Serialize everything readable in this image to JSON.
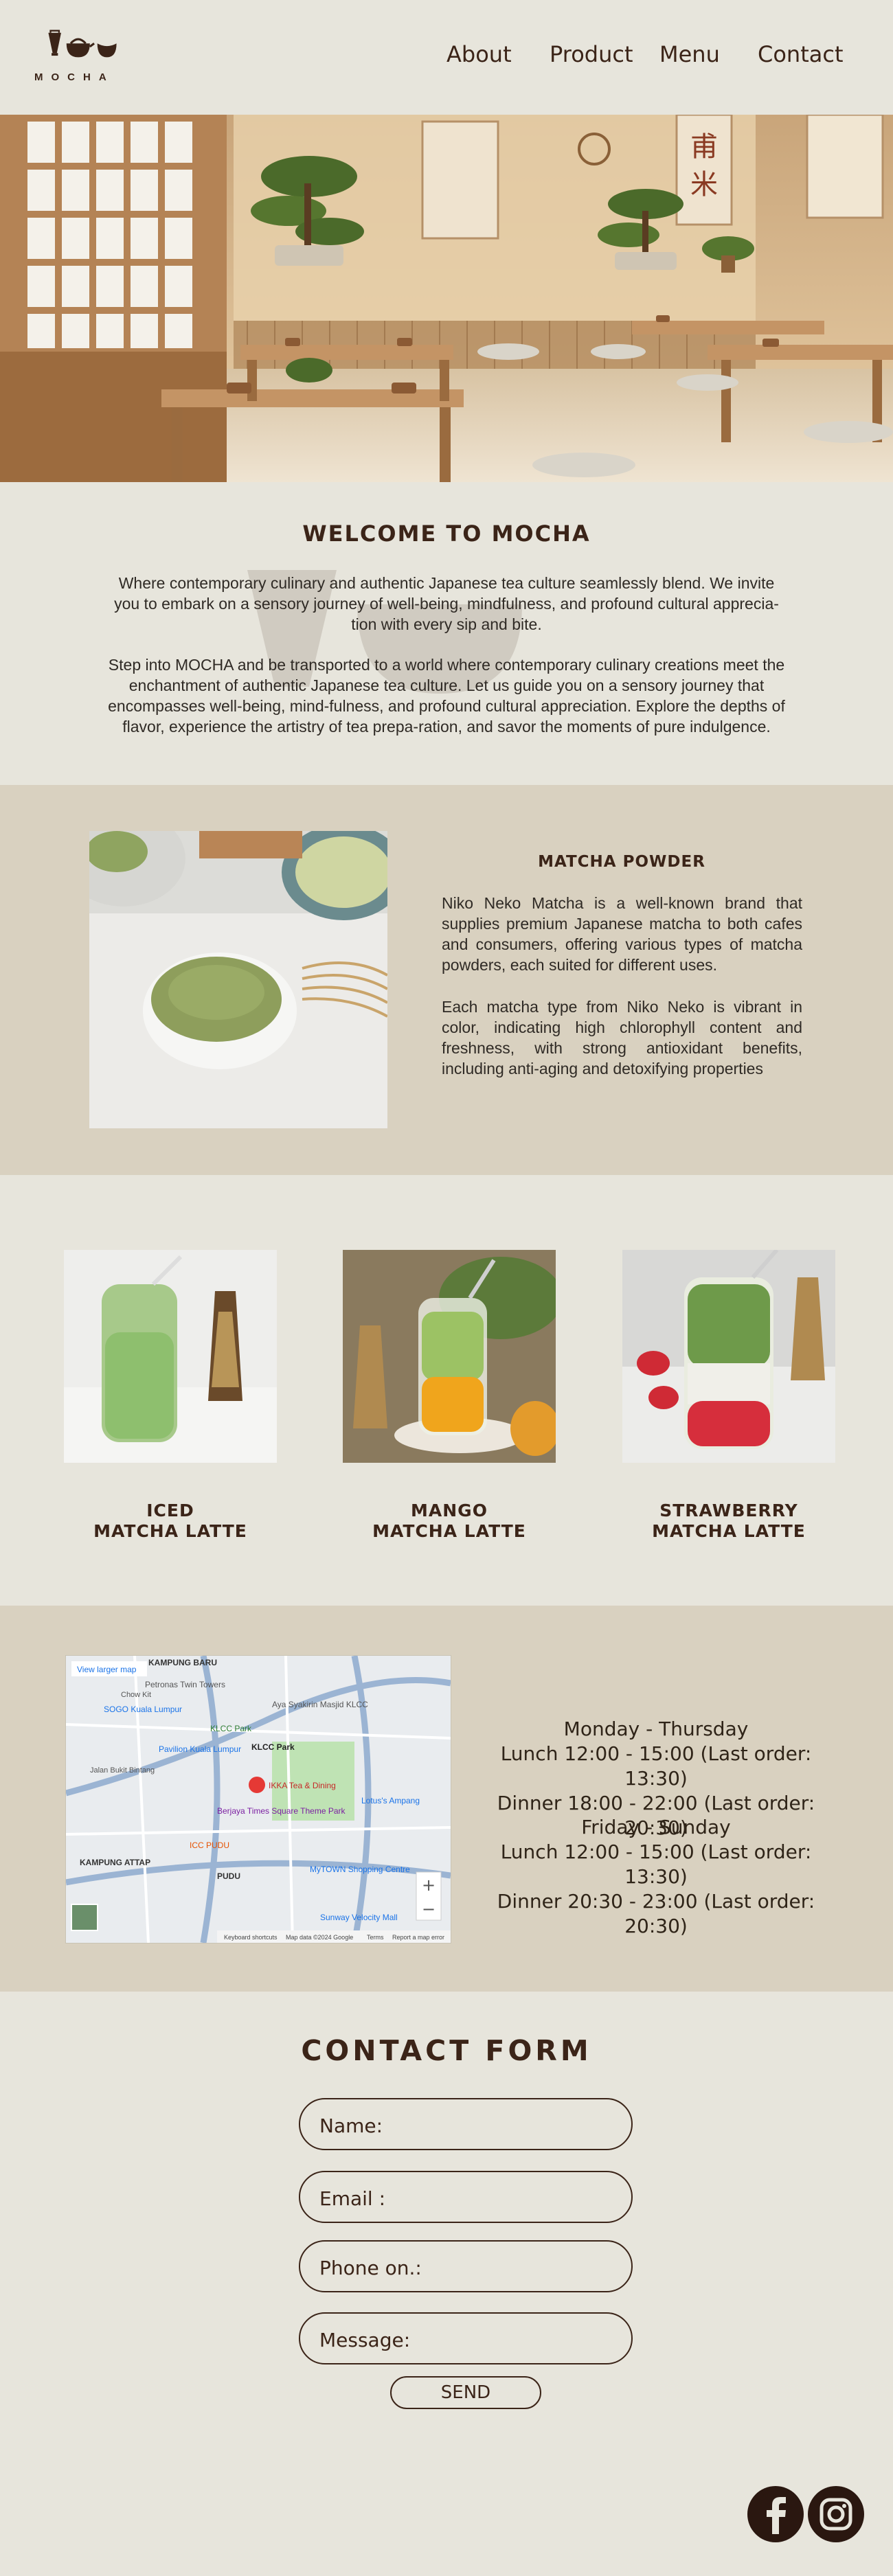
{
  "brand": {
    "logo_text": "MOCHA"
  },
  "nav": [
    {
      "label": "About"
    },
    {
      "label": "Product"
    },
    {
      "label": "Menu"
    },
    {
      "label": "Contact"
    }
  ],
  "welcome": {
    "title": "WELCOME TO MOCHA",
    "para1_lines": [
      "Where contemporary culinary and authentic Japanese tea culture seamlessly blend. We invite",
      "you to embark on a sensory journey of well-being, mindfulness, and profound cultural apprecia-",
      "tion with every sip and bite."
    ],
    "para2_lines": [
      "Step into MOCHA and be transported to a world where contemporary culinary creations meet the",
      "enchantment of authentic Japanese tea culture. Let us guide you on a sensory journey that",
      "encompasses well-being, mind-fulness, and profound cultural appreciation. Explore the depths of",
      "flavor, experience the artistry of tea prepa-ration, and savor the moments of pure indulgence."
    ]
  },
  "matcha": {
    "title": "MATCHA POWDER",
    "para1": "Niko Neko Matcha is a well-known brand that supplies premium Japanese matcha to both cafes and consumers, offering various types of matcha powders, each suited for different uses.",
    "para2": "Each matcha type from Niko Neko is vibrant in color, indicating high chlorophyll content and freshness, with strong antioxidant benefits, including anti-aging and detoxifying properties"
  },
  "drinks": [
    {
      "line1": "ICED",
      "line2": "MATCHA LATTE"
    },
    {
      "line1": "MANGO",
      "line2": "MATCHA LATTE"
    },
    {
      "line1": "STRAWBERRY",
      "line2": "MATCHA LATTE"
    }
  ],
  "map": {
    "link": "View larger map",
    "labels": [
      "KAMPUNG BARU",
      "Petronas Twin Towers",
      "SOGO Kuala Lumpur",
      "KLCC Park",
      "Pavilion Kuala Lumpur",
      "KLCC Park",
      "IKKA Tea & Dining",
      "Berjaya Times Square Theme Park",
      "ICC PUDU",
      "KAMPUNG ATTAP",
      "PUDU",
      "MyTOWN Shopping Centre",
      "Sunway Velocity Mall",
      "Lotus's Ampang",
      "Aya Syakirin Masjid KLCC",
      "Chow Kit",
      "Jalan Bukit Bintang"
    ],
    "zoom_in": "+",
    "zoom_out": "−",
    "footer": [
      "Keyboard shortcuts",
      "Map data ©2024 Google",
      "Terms",
      "Report a map error"
    ]
  },
  "hours": {
    "weekday_title": "Monday - Thursday",
    "weekday_lunch": "Lunch 12:00 - 15:00 (Last order: 13:30)",
    "weekday_dinner": "Dinner 18:00 - 22:00 (Last order: 20:30)",
    "weekend_title": "Friday - Sunday",
    "weekend_lunch": "Lunch 12:00 - 15:00 (Last order: 13:30)",
    "weekend_dinner": "Dinner 20:30 - 23:00 (Last order: 20:30)"
  },
  "contact": {
    "title": "CONTACT FORM",
    "fields": [
      {
        "label": "Name:"
      },
      {
        "label": "Email :"
      },
      {
        "label": "Phone on.:"
      },
      {
        "label": "Message:"
      }
    ],
    "send_label": "SEND"
  },
  "social": [
    {
      "icon": "facebook-icon"
    },
    {
      "icon": "instagram-icon"
    }
  ],
  "colors": {
    "background": "#e7e5dc",
    "band": "#d9d1c0",
    "brown": "#3b2418",
    "matcha_green": "#8fa460"
  }
}
